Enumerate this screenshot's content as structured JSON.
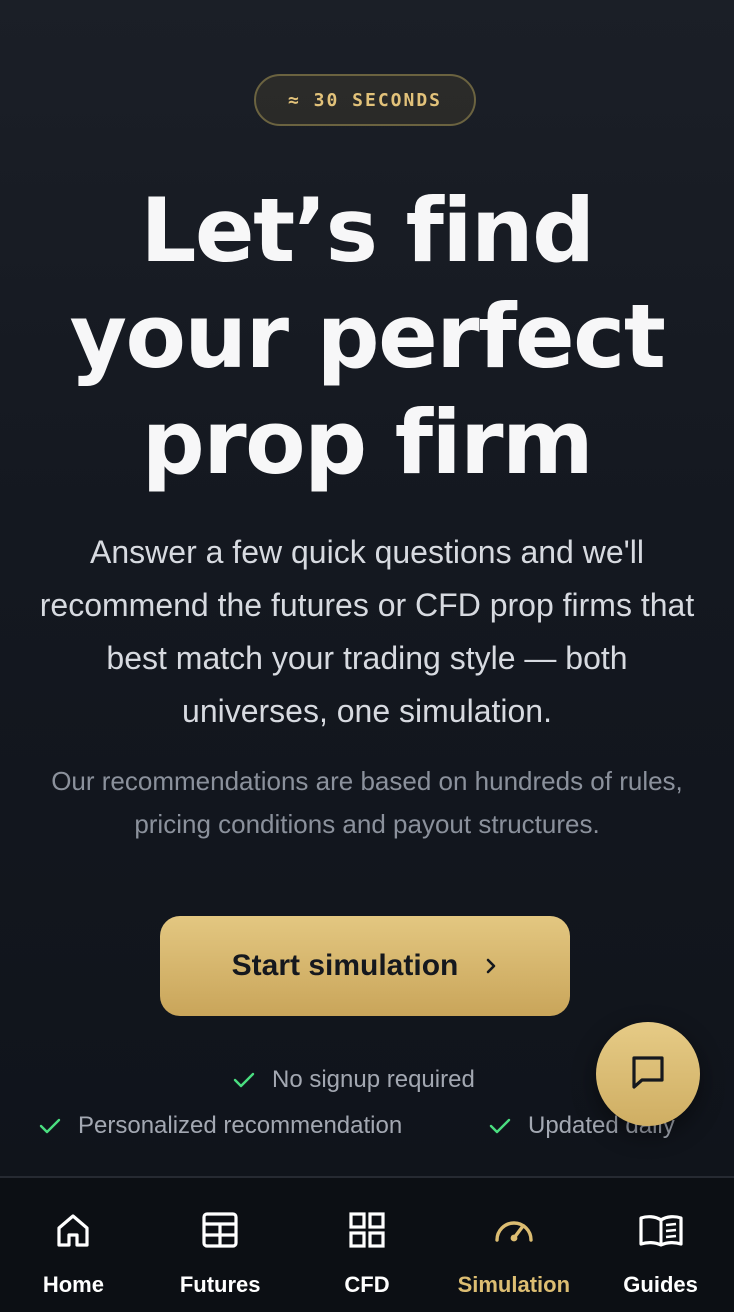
{
  "badge": {
    "text": "≈ 30 SECONDS"
  },
  "hero": {
    "title_lines": [
      "Let’s find",
      "your perfect",
      "prop firm"
    ],
    "lead": "Answer a few quick questions and we'll recommend the futures or CFD prop firms that best match your trading style — both universes, one simulation.",
    "sub": "Our recommendations are based on hundreds of rules, pricing conditions and payout structures."
  },
  "cta": {
    "label": "Start simulation",
    "icon": "chevron-right-icon"
  },
  "features": [
    {
      "label": "No signup required",
      "icon": "check-icon"
    },
    {
      "label": "Personalized recommendation",
      "icon": "check-icon"
    },
    {
      "label": "Updated daily",
      "icon": "check-icon"
    }
  ],
  "chat": {
    "icon": "chat-bubble-icon"
  },
  "nav": {
    "items": [
      {
        "label": "Home",
        "icon": "home-icon"
      },
      {
        "label": "Futures",
        "icon": "table-icon"
      },
      {
        "label": "CFD",
        "icon": "grid-icon"
      },
      {
        "label": "Simulation",
        "icon": "speedometer-icon",
        "active": true
      },
      {
        "label": "Guides",
        "icon": "book-icon"
      }
    ]
  },
  "colors": {
    "accent": "#dcbd72",
    "check": "#4ade80",
    "background": "#141820"
  }
}
